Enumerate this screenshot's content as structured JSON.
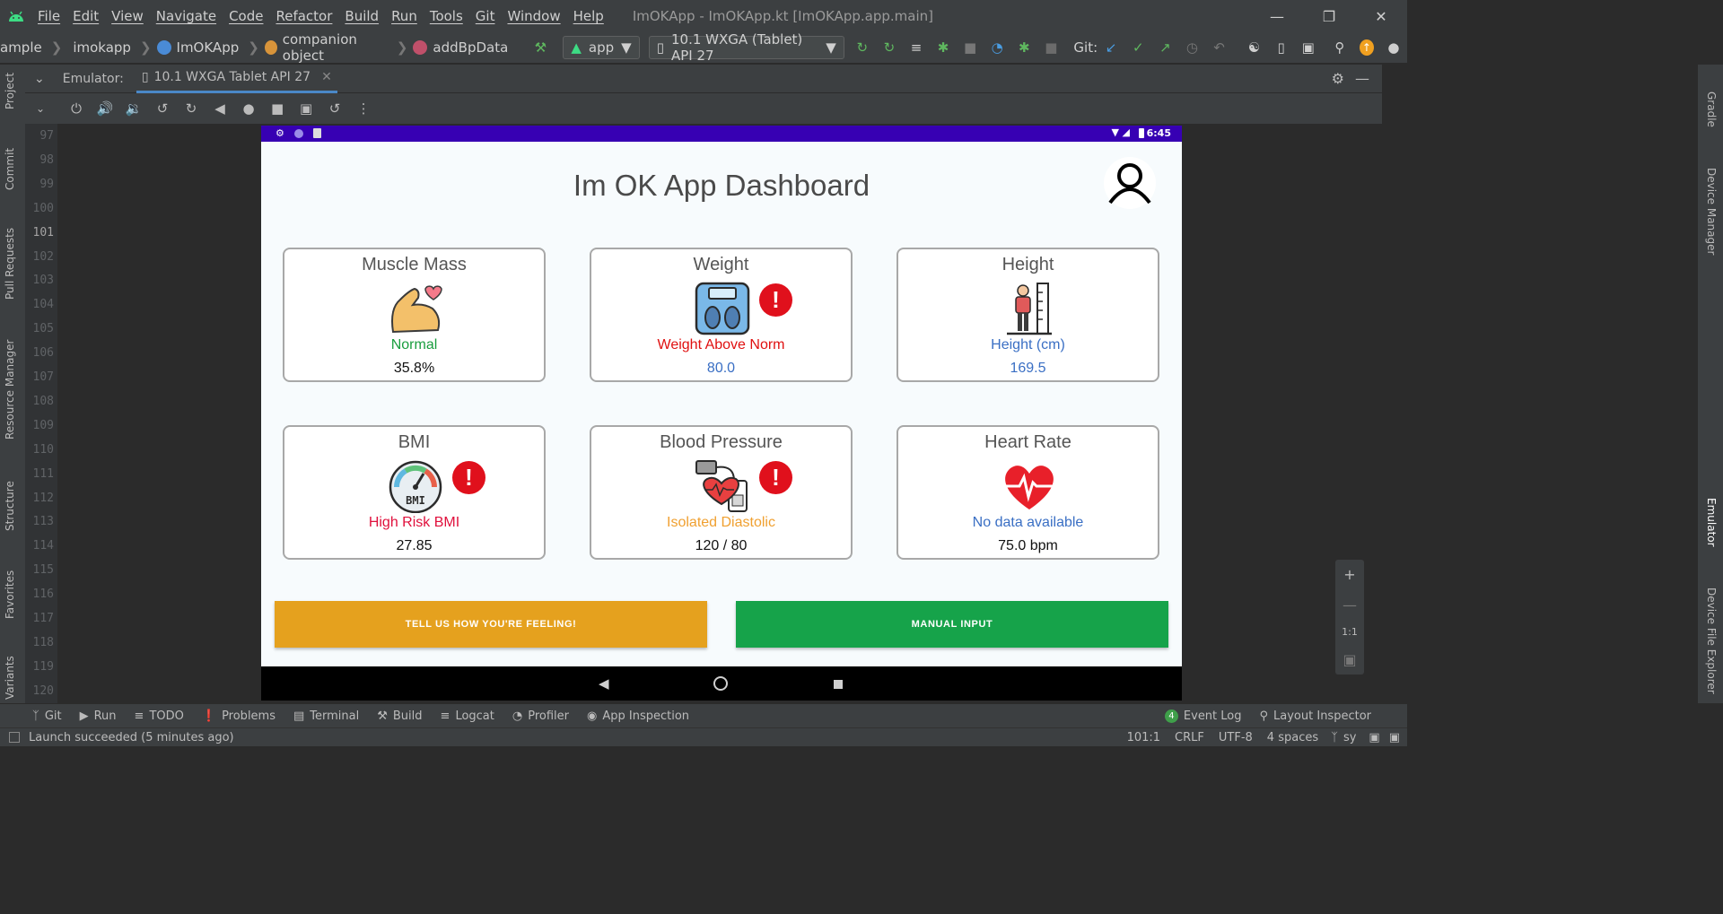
{
  "menubar": {
    "items": [
      "File",
      "Edit",
      "View",
      "Navigate",
      "Code",
      "Refactor",
      "Build",
      "Run",
      "Tools",
      "Git",
      "Window",
      "Help"
    ],
    "window_title": "ImOKApp - ImOKApp.kt [ImOKApp.app.main]"
  },
  "navbar": {
    "breadcrumbs": [
      "ample",
      "imokapp",
      "ImOKApp",
      "companion object",
      "addBpData"
    ],
    "run_config": "app",
    "device": "10.1  WXGA (Tablet) API 27",
    "git_label": "Git:"
  },
  "left_tools": [
    "Project",
    "Commit",
    "Pull Requests",
    "Resource Manager",
    "Structure",
    "Favorites",
    "Variants"
  ],
  "right_tools": [
    "Gradle",
    "Device Manager",
    "Emulator",
    "Device File Explorer"
  ],
  "emulator": {
    "label": "Emulator:",
    "tab": "10.1 WXGA Tablet API 27",
    "zoom_label": "1:1"
  },
  "line_numbers": [
    "97",
    "98",
    "99",
    "100",
    "101",
    "102",
    "103",
    "104",
    "105",
    "106",
    "107",
    "108",
    "109",
    "110",
    "111",
    "112",
    "113",
    "114",
    "115",
    "116",
    "117",
    "118",
    "119",
    "120"
  ],
  "device": {
    "time": "6:45",
    "title": "Im OK App Dashboard",
    "cards": [
      {
        "title": "Muscle Mass",
        "status": "Normal",
        "value": "35.8%",
        "status_color": "#1a9e3f",
        "value_color": "#111111",
        "icon": "flexed-arm-icon",
        "alert": false
      },
      {
        "title": "Weight",
        "status": "Weight Above Norm",
        "value": "80.0",
        "status_color": "#e01010",
        "value_color": "#3a6fc4",
        "icon": "scale-icon",
        "alert": true
      },
      {
        "title": "Height",
        "status": "Height (cm)",
        "value": "169.5",
        "status_color": "#3a6fc4",
        "value_color": "#3a6fc4",
        "icon": "height-measure-icon",
        "alert": false
      },
      {
        "title": "BMI",
        "status": "High Risk BMI",
        "value": "27.85",
        "status_color": "#e0103c",
        "value_color": "#111111",
        "icon": "bmi-gauge-icon",
        "alert": true
      },
      {
        "title": "Blood Pressure",
        "status": "Isolated Diastolic",
        "value": "120 / 80",
        "status_color": "#f0a030",
        "value_color": "#111111",
        "icon": "blood-pressure-icon",
        "alert": true
      },
      {
        "title": "Heart Rate",
        "status": "No data available",
        "value": "75.0 bpm",
        "status_color": "#3a6fc4",
        "value_color": "#111111",
        "icon": "heart-rate-icon",
        "alert": false
      }
    ],
    "alert_symbol": "!",
    "buttons": {
      "feeling": "TELL US HOW YOU'RE FEELING!",
      "manual": "MANUAL INPUT"
    },
    "colors": {
      "status_bar": "#3700b3",
      "feeling_button": "#e5a11e",
      "manual_button": "#16a34a"
    }
  },
  "bottom_tools": [
    "Git",
    "Run",
    "TODO",
    "Problems",
    "Terminal",
    "Build",
    "Logcat",
    "Profiler",
    "App Inspection"
  ],
  "event_log": {
    "count": "4",
    "label": "Event Log"
  },
  "layout_inspector": "Layout Inspector",
  "status": {
    "message": "Launch succeeded (5 minutes ago)",
    "position": "101:1",
    "line_sep": "CRLF",
    "encoding": "UTF-8",
    "indent": "4 spaces",
    "vcs": "sy"
  }
}
